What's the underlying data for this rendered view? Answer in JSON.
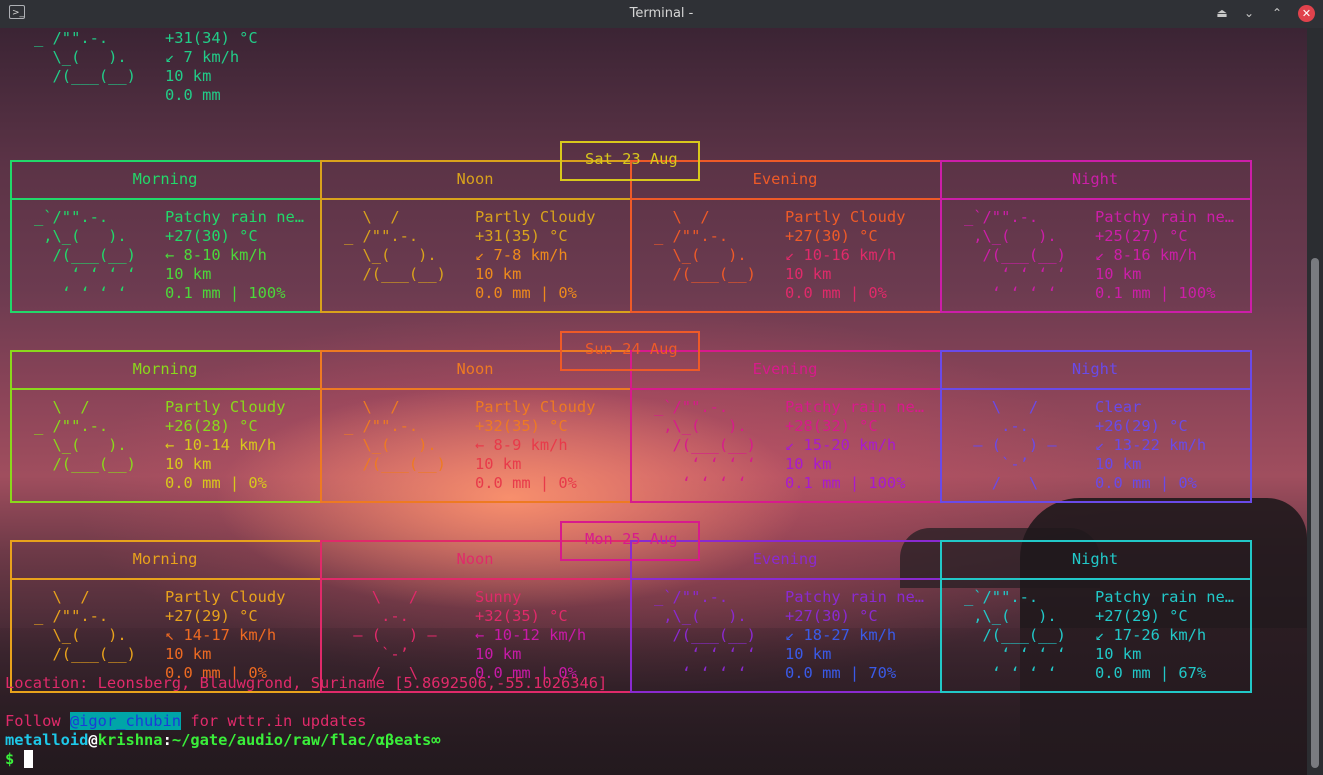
{
  "window": {
    "title": "Terminal -"
  },
  "current": {
    "lines": [
      {
        "art": "_ /\"\".-.",
        "info": "+31(34) °C"
      },
      {
        "art": "  \\_(   ).",
        "info": "↙ 7 km/h"
      },
      {
        "art": "  /(___(__)",
        "info": "10 km"
      },
      {
        "art": "",
        "info": "0.0 mm"
      }
    ]
  },
  "days": [
    {
      "date": "Sat 23 Aug",
      "periods": [
        {
          "name": "Morning",
          "art": [
            "_`/\"\".-.",
            " ,\\_(   ).",
            "  /(___(__)",
            "    ‘ ‘ ‘ ‘",
            "   ‘ ‘ ‘ ‘"
          ],
          "info": [
            "Patchy rain ne…",
            "+27(30) °C",
            "← 8-10 km/h",
            "10 km",
            "0.1 mm | 100%"
          ]
        },
        {
          "name": "Noon",
          "art": [
            "  \\  /",
            "_ /\"\".-.",
            "  \\_(   ).",
            "  /(___(__)",
            ""
          ],
          "info": [
            "Partly Cloudy",
            "+31(35) °C",
            "↙ 7-8 km/h",
            "10 km",
            "0.0 mm | 0%"
          ]
        },
        {
          "name": "Evening",
          "art": [
            "  \\  /",
            "_ /\"\".-.",
            "  \\_(   ).",
            "  /(___(__)",
            ""
          ],
          "info": [
            "Partly Cloudy",
            "+27(30) °C",
            "↙ 10-16 km/h",
            "10 km",
            "0.0 mm | 0%"
          ]
        },
        {
          "name": "Night",
          "art": [
            "_`/\"\".-.",
            " ,\\_(   ).",
            "  /(___(__)",
            "    ‘ ‘ ‘ ‘",
            "   ‘ ‘ ‘ ‘"
          ],
          "info": [
            "Patchy rain ne…",
            "+25(27) °C",
            "↙ 8-16 km/h",
            "10 km",
            "0.1 mm | 100%"
          ]
        }
      ]
    },
    {
      "date": "Sun 24 Aug",
      "periods": [
        {
          "name": "Morning",
          "art": [
            "  \\  /",
            "_ /\"\".-.",
            "  \\_(   ).",
            "  /(___(__)",
            ""
          ],
          "info": [
            "Partly Cloudy",
            "+26(28) °C",
            "← 10-14 km/h",
            "10 km",
            "0.0 mm | 0%"
          ]
        },
        {
          "name": "Noon",
          "art": [
            "  \\  /",
            "_ /\"\".-.",
            "  \\_(   ).",
            "  /(___(__)",
            ""
          ],
          "info": [
            "Partly Cloudy",
            "+32(35) °C",
            "← 8-9 km/h",
            "10 km",
            "0.0 mm | 0%"
          ]
        },
        {
          "name": "Evening",
          "art": [
            "_`/\"\".-.",
            " ,\\_(   ).",
            "  /(___(__)",
            "    ‘ ‘ ‘ ‘",
            "   ‘ ‘ ‘ ‘"
          ],
          "info": [
            "Patchy rain ne…",
            "+28(32) °C",
            "↙ 15-20 km/h",
            "10 km",
            "0.1 mm | 100%"
          ]
        },
        {
          "name": "Night",
          "art": [
            "   \\   /",
            "    .-.",
            " ― (   ) ―",
            "    `-’",
            "   /   \\"
          ],
          "info": [
            "Clear",
            "+26(29) °C",
            "↙ 13-22 km/h",
            "10 km",
            "0.0 mm | 0%"
          ]
        }
      ]
    },
    {
      "date": "Mon 25 Aug",
      "periods": [
        {
          "name": "Morning",
          "art": [
            "  \\  /",
            "_ /\"\".-.",
            "  \\_(   ).",
            "  /(___(__)",
            ""
          ],
          "info": [
            "Partly Cloudy",
            "+27(29) °C",
            "↖ 14-17 km/h",
            "10 km",
            "0.0 mm | 0%"
          ]
        },
        {
          "name": "Noon",
          "art": [
            "   \\   /",
            "    .-.",
            " ― (   ) ―",
            "    `-’",
            "   /   \\"
          ],
          "info": [
            "Sunny",
            "+32(35) °C",
            "← 10-12 km/h",
            "10 km",
            "0.0 mm | 0%"
          ]
        },
        {
          "name": "Evening",
          "art": [
            "_`/\"\".-.",
            " ,\\_(   ).",
            "  /(___(__)",
            "    ‘ ‘ ‘ ‘",
            "   ‘ ‘ ‘ ‘"
          ],
          "info": [
            "Patchy rain ne…",
            "+27(30) °C",
            "↙ 18-27 km/h",
            "10 km",
            "0.0 mm | 70%"
          ]
        },
        {
          "name": "Night",
          "art": [
            "_`/\"\".-.",
            " ,\\_(   ).",
            "  /(___(__)",
            "    ‘ ‘ ‘ ‘",
            "   ‘ ‘ ‘ ‘"
          ],
          "info": [
            "Patchy rain ne…",
            "+27(29) °C",
            "↙ 17-26 km/h",
            "10 km",
            "0.0 mm | 67%"
          ]
        }
      ]
    }
  ],
  "location": "Location: Leonsberg, Blauwgrond, Suriname [5.8692506,-55.1026346]",
  "follow": {
    "prefix": "Follow ",
    "handle": "@igor_chubin",
    "suffix": " for wttr.in updates"
  },
  "prompt": {
    "user": "metalloid",
    "at": "@",
    "host": "krishna",
    "sep": ":",
    "path": "~/gate/audio/raw/flac/αβeats∞",
    "symbol": "$ "
  },
  "colors": {
    "days": [
      [
        "#22d86a",
        "#4cd83a",
        "#d9a21c",
        "#ee8a1c",
        "#ee5a28",
        "#e02a6a",
        "#cc1ea8"
      ],
      [
        "#8ad81c",
        "#d8c81c",
        "#ee7a22",
        "#e83a4a",
        "#d81a8c",
        "#a81ad0",
        "#6a4ae8"
      ],
      [
        "#e8a21c",
        "#ee6a22",
        "#e02a6a",
        "#c81aa8",
        "#8a2ad0",
        "#3a5ae8",
        "#22c8c8"
      ]
    ],
    "dateLabels": [
      "#d8c81c",
      "#ee5a28",
      "#d81a8c"
    ],
    "current": "#22cc88",
    "location": "#e02a6a",
    "follow": "#e02a6a",
    "user": "#1ec8e8",
    "host": "#3aee3a",
    "path": "#3aee3a"
  }
}
